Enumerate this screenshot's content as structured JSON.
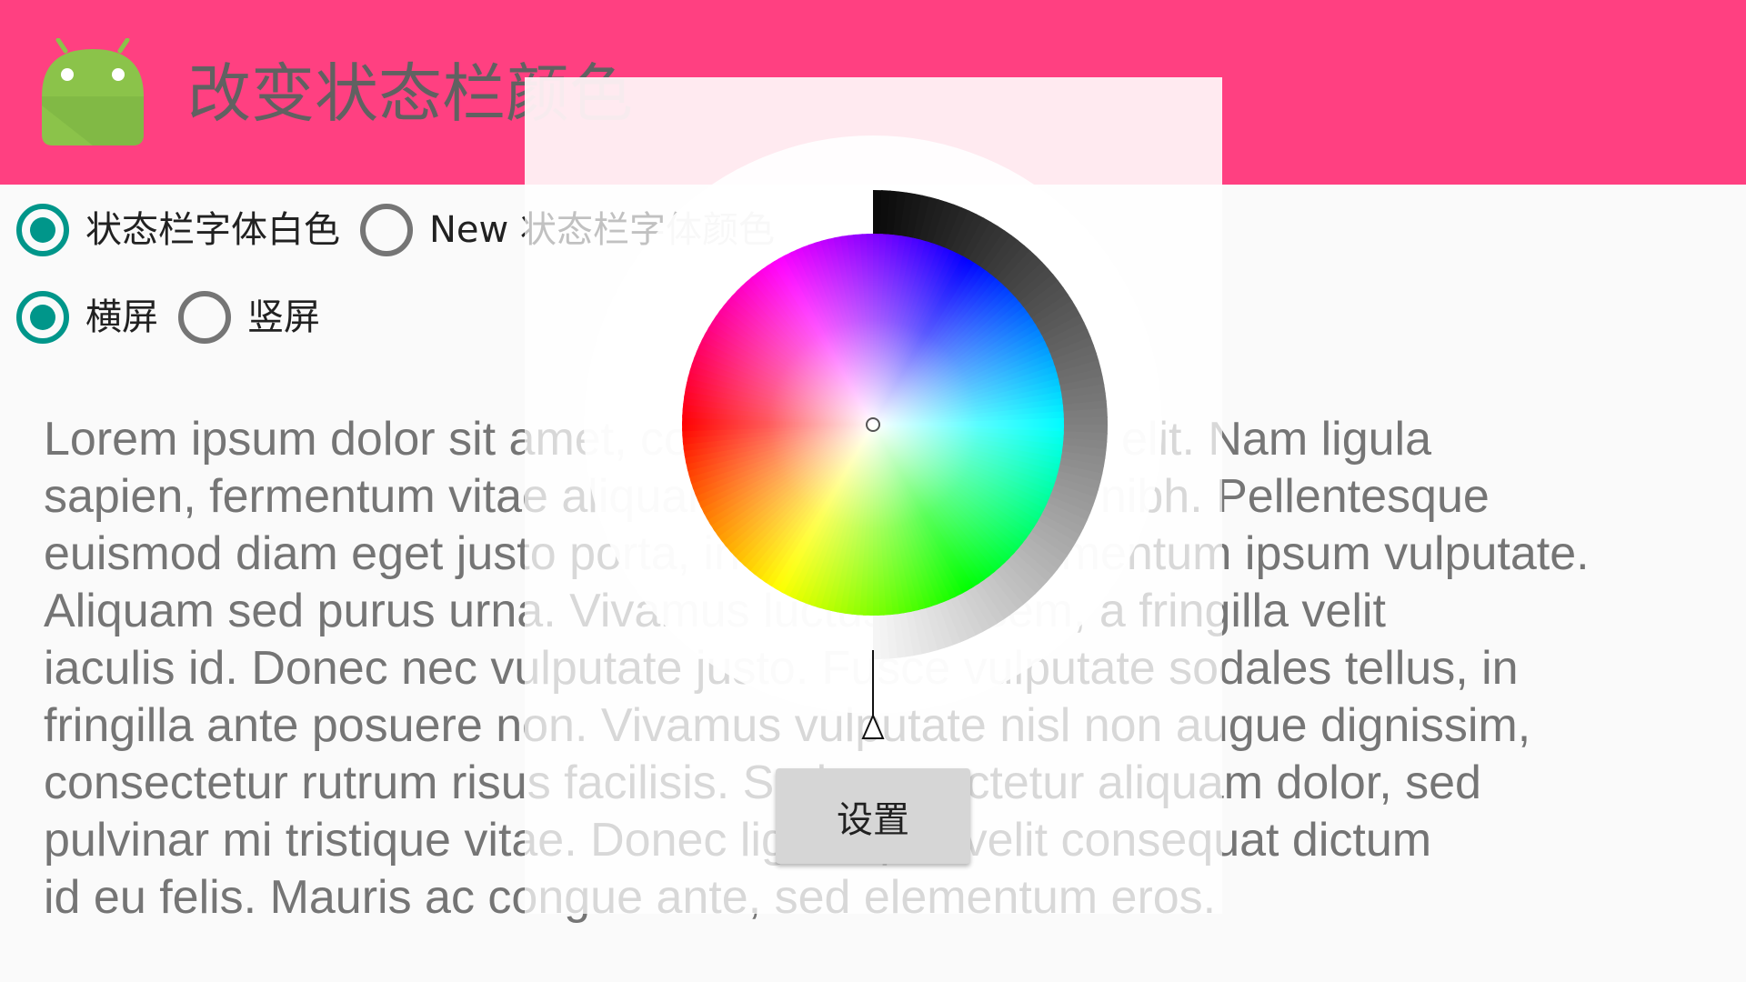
{
  "colors": {
    "toolbar": "#ff4081",
    "radio_accent": "#00968a",
    "background": "#fafafa"
  },
  "toolbar": {
    "title": "改变状态栏颜色",
    "logo_icon": "android-robot-icon"
  },
  "radio_groups": {
    "font_color": {
      "option_white": "状态栏字体白色",
      "option_new": "New 状态栏字体颜色",
      "selected": "option_white"
    },
    "orientation": {
      "option_landscape": "横屏",
      "option_portrait": "竖屏",
      "selected": "option_landscape"
    }
  },
  "body_lines": [
    "Lorem ipsum dolor sit amet, consectetur adipiscing elit. Nam ligula",
    "sapien, fermentum vitae aliquam quis, interdum in nibh. Pellentesque",
    "euismod diam eget justo porta, in euismod ut elementum ipsum vulputate.",
    "Aliquam sed purus urna. Vivamus luctus nisi sem, a fringilla velit",
    "iaculis id. Donec nec vulputate justo. Fusce vulputate sodales tellus, in",
    "fringilla ante posuere non. Vivamus vulputate nisl non augue dignissim,",
    "consectetur rutrum risus facilisis. Sed consectetur aliquam dolor, sed",
    "pulvinar mi tristique vitae. Donec ligula quis velit consequat dictum",
    "id eu felis. Mauris ac congue ante, sed elementum eros."
  ],
  "color_picker": {
    "wheel_icon": "color-wheel",
    "value_ring_icon": "value-gradient-ring",
    "value_pointer_icon": "value-pointer-triangle",
    "set_button_label": "设置"
  }
}
